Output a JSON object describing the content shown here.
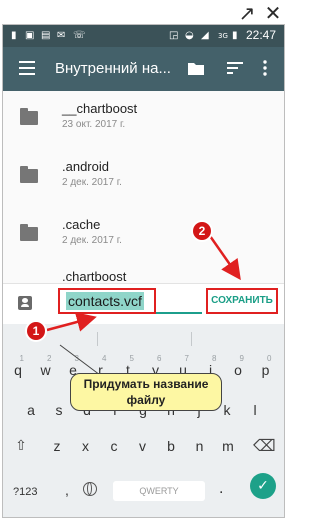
{
  "status_bar": {
    "time": "22:47",
    "network": "3G",
    "icons": [
      "sim-icon",
      "photo-icon",
      "message-icon",
      "mail-icon",
      "phone-icon",
      "cast-icon",
      "wifi-icon",
      "signal-icon",
      "battery-icon"
    ]
  },
  "app_bar": {
    "title": "Внутренний на...",
    "icons": [
      "menu-icon",
      "folder-icon",
      "sort-icon",
      "more-icon"
    ]
  },
  "files": [
    {
      "name": "__chartboost",
      "date": "23 окт. 2017 г."
    },
    {
      "name": ".android",
      "date": "2 дек. 2017 г."
    },
    {
      "name": ".cache",
      "date": "2 дек. 2017 г."
    },
    {
      "name": ".chartboost",
      "date": ""
    }
  ],
  "save_bar": {
    "filename_value": "contacts.vcf",
    "save_label": "СОХРАНИТЬ"
  },
  "keyboard": {
    "row1": [
      "q",
      "w",
      "e",
      "r",
      "t",
      "y",
      "u",
      "i",
      "o",
      "p"
    ],
    "row1_hints": [
      "1",
      "2",
      "3",
      "4",
      "5",
      "6",
      "7",
      "8",
      "9",
      "0"
    ],
    "row2": [
      "a",
      "s",
      "d",
      "f",
      "g",
      "h",
      "j",
      "k",
      "l"
    ],
    "row3": [
      "z",
      "x",
      "c",
      "v",
      "b",
      "n",
      "m"
    ],
    "mode_label": "?123",
    "comma": ",",
    "space_label": "QWERTY",
    "period": "."
  },
  "annotations": {
    "badge1": "1",
    "badge2": "2",
    "callout_line1": "Придумать название",
    "callout_line2": "файлу"
  },
  "colors": {
    "status_bar": "#3b5258",
    "app_bar": "#44616a",
    "accent": "#1a9e86",
    "highlight": "#e02020",
    "callout_bg": "#fdf7a3"
  }
}
